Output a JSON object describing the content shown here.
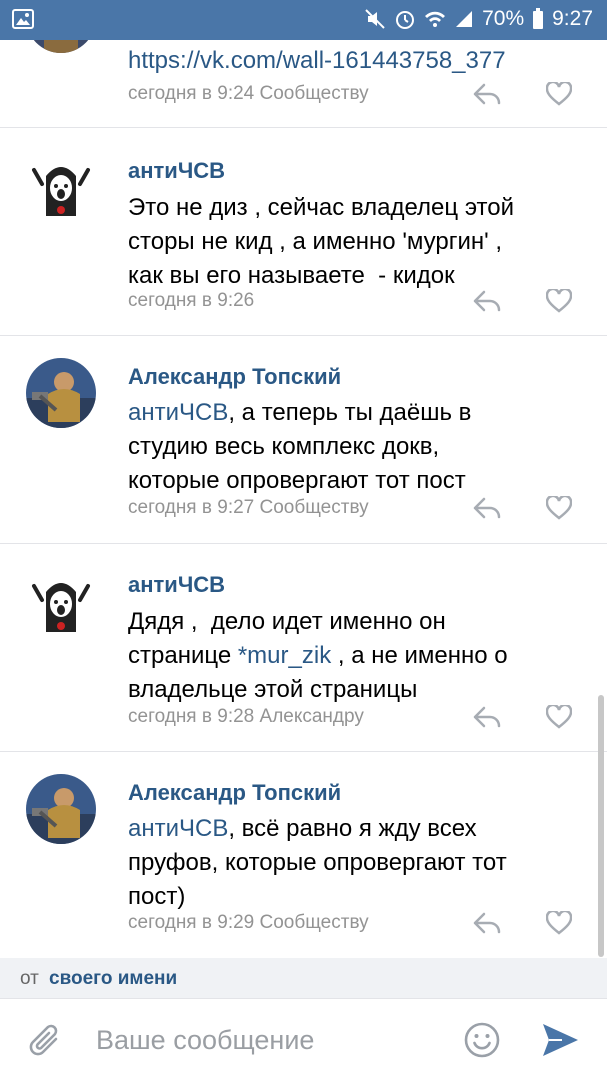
{
  "status_bar": {
    "battery": "70%",
    "time": "9:27"
  },
  "comments": [
    {
      "author": "",
      "text_link": "https://vk.com/wall-161443758_377",
      "time": "сегодня в 9:24",
      "reply_to": "Сообществу"
    },
    {
      "author": "антиЧСВ",
      "text": "Это не диз , сейчас владелец этой\nсторы не кид , а именно 'мургин' ,\nкак вы его называете  - кидок",
      "time": "сегодня в 9:26",
      "reply_to": ""
    },
    {
      "author": "Александр Топский",
      "mention": "антиЧСВ",
      "text": ", а теперь ты даёшь в\nстудию весь комплекс докв,\nкоторые опровергают тот пост",
      "time": "сегодня в 9:27",
      "reply_to": "Сообществу"
    },
    {
      "author": "антиЧСВ",
      "text_pre": "Дядя ,  дело идет именно он\nстранице ",
      "text_link": "*mur_zik",
      "text_post": " , а не именно о\nвладельце этой страницы",
      "time": "сегодня в 9:28",
      "reply_to": "Александру"
    },
    {
      "author": "Александр Топский",
      "mention": "антиЧСВ",
      "text": ", всё равно я жду всех\nпруфов, которые опровергают тот\nпост)",
      "time": "сегодня в 9:29",
      "reply_to": "Сообществу"
    }
  ],
  "from_bar": {
    "prefix": "от",
    "link": "своего имени"
  },
  "composer": {
    "placeholder": "Ваше сообщение"
  },
  "icons": {
    "status": [
      "image-icon",
      "mute-icon",
      "alarm-icon",
      "wifi-icon",
      "signal-icon",
      "battery-icon"
    ],
    "comment": [
      "reply-icon",
      "heart-icon"
    ],
    "composer": [
      "attach-icon",
      "emoji-icon",
      "send-icon"
    ]
  },
  "colors": {
    "header": "#4a76a8",
    "link": "#2a5885",
    "meta": "#939393",
    "send": "#4a76a8"
  }
}
